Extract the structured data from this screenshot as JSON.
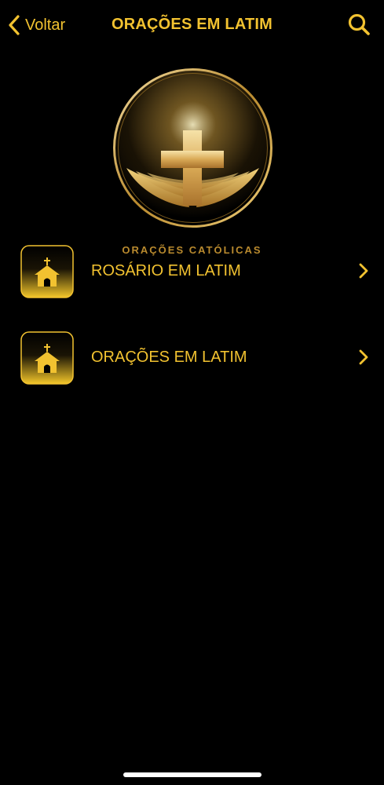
{
  "nav": {
    "back_label": "Voltar",
    "title": "ORAÇÕES EM LATIM",
    "search_icon": "search-icon"
  },
  "logo": {
    "caption": "ORAÇÕES CATÓLICAS",
    "icon": "cross-with-wings-logo"
  },
  "list": {
    "items": [
      {
        "label": "ROSÁRIO EM LATIM",
        "icon": "church-icon"
      },
      {
        "label": "ORAÇÕES EM LATIM",
        "icon": "church-icon"
      }
    ]
  },
  "colors": {
    "accent": "#f2c230",
    "background": "#000000",
    "gold_dark": "#b98a2e"
  }
}
